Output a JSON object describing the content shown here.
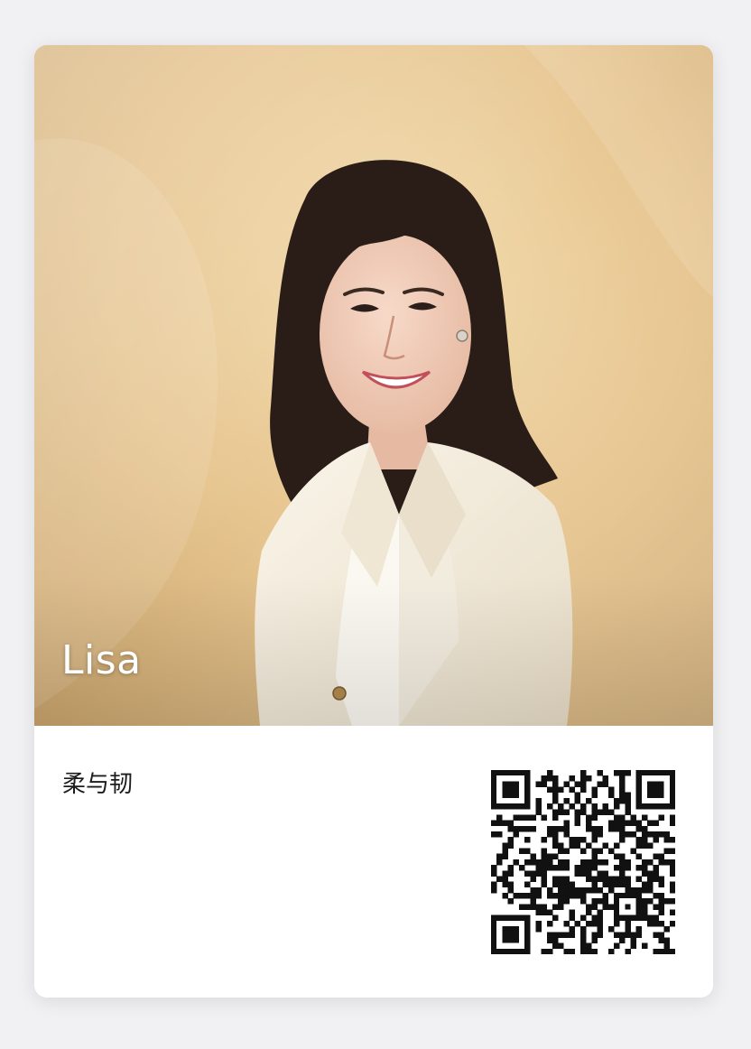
{
  "profile": {
    "name": "Lisa",
    "signature": "柔与韧"
  },
  "qr_code": {
    "icon": "qr-code-icon"
  },
  "colors": {
    "backdrop": "#e2c08a",
    "page_background": "#f1f1f3",
    "card_background": "#ffffff",
    "name_text": "#ffffff",
    "signature_text": "#1c1c1c"
  }
}
